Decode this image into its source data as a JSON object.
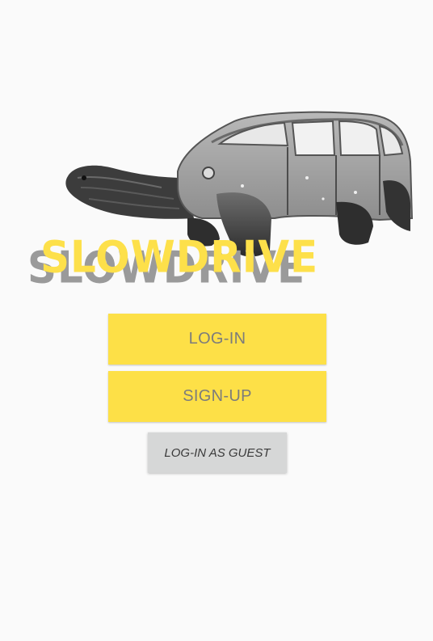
{
  "app": {
    "logo_text": "SLOWDRIVE",
    "accent_color": "#fde047",
    "hero_image": "tortoise-car-illustration"
  },
  "buttons": {
    "login_label": "LOG-IN",
    "signup_label": "SIGN-UP",
    "guest_label": "LOG-IN AS GUEST"
  }
}
